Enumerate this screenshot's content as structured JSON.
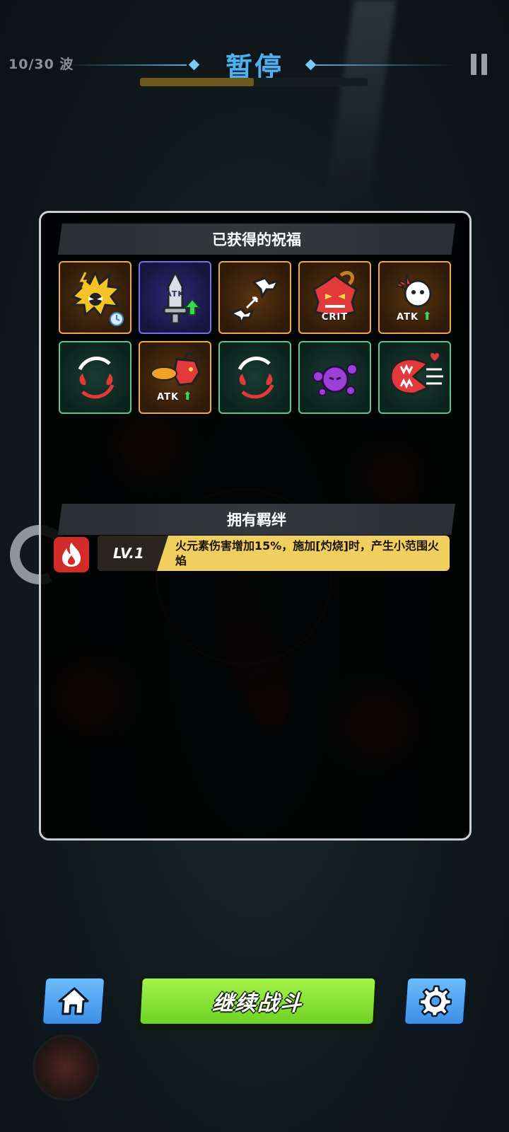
{
  "header": {
    "wave": "10/30 波",
    "title": "暂停",
    "wave_progress": 0.5
  },
  "panel": {
    "blessings_title": "已获得的祝福",
    "blessings": [
      {
        "icon": "lightning-hedgehog-icon",
        "frame": "orange",
        "tag": ""
      },
      {
        "icon": "atk-sword-up-icon",
        "frame": "purple",
        "tag": "ATK"
      },
      {
        "icon": "flying-birds-icon",
        "frame": "orange",
        "tag": ""
      },
      {
        "icon": "demon-crit-icon",
        "frame": "orange",
        "tag": "CRIT"
      },
      {
        "icon": "ghost-atk-up-icon",
        "frame": "orange",
        "tag": "ATK"
      },
      {
        "icon": "fire-cycle-icon",
        "frame": "green",
        "tag": ""
      },
      {
        "icon": "dragon-breath-atk-icon",
        "frame": "orange",
        "tag": "ATK"
      },
      {
        "icon": "fire-cycle-icon",
        "frame": "green",
        "tag": ""
      },
      {
        "icon": "purple-slime-icon",
        "frame": "green",
        "tag": ""
      },
      {
        "icon": "red-chomper-icon",
        "frame": "green",
        "tag": ""
      }
    ],
    "bonds_title": "拥有羁绊",
    "bond": {
      "icon": "fire-element-icon",
      "level": "LV.1",
      "description": "火元素伤害增加15%，施加[灼烧]时，产生小范围火焰"
    }
  },
  "footer": {
    "home_icon": "home-icon",
    "continue_label": "继续战斗",
    "settings_icon": "gear-icon"
  },
  "colors": {
    "title_blue": "#4fb1ee",
    "continue_green": "#8be536",
    "bond_yellow": "#f0cf5e",
    "frame_orange": "#f0a93a",
    "frame_green": "#58c88f",
    "frame_purple": "#7b6cf0"
  }
}
